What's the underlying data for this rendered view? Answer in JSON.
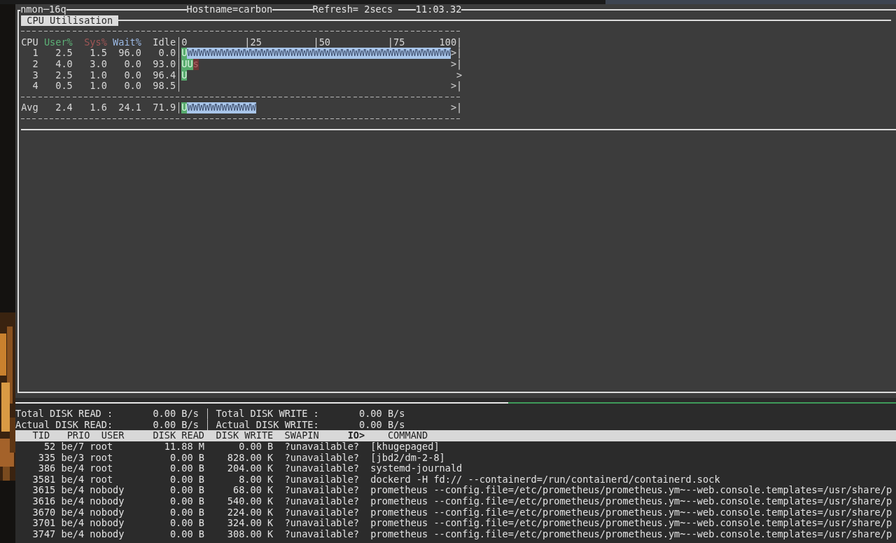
{
  "header": {
    "title": "nmon─16q",
    "hostname": "Hostname=carbon",
    "refresh": "Refresh= 2secs",
    "time": "11:03.32"
  },
  "cpu_panel": {
    "title": "CPU Utilisation",
    "columns": [
      {
        "label": "CPU",
        "kind": "cpu"
      },
      {
        "label": "User%",
        "kind": "user"
      },
      {
        "label": "Sys%",
        "kind": "sys"
      },
      {
        "label": "Wait%",
        "kind": "wait"
      },
      {
        "label": "Idle",
        "kind": "idle"
      }
    ],
    "scale": [
      "0",
      "|25",
      "|50",
      "|75",
      "100|"
    ],
    "rows": [
      {
        "cpu": "1",
        "user": "2.5",
        "sys": "1.5",
        "wait": "96.0",
        "idle": "0.0",
        "bar": [
          {
            "kind": "user",
            "text": "U"
          },
          {
            "kind": "wait",
            "text": "WWWWWWWWWWWWWWWWWWWWWWWWWWWWWWWWWWWWWWWWWWWWWW"
          }
        ],
        "end": ">|"
      },
      {
        "cpu": "2",
        "user": "4.0",
        "sys": "3.0",
        "wait": "0.0",
        "idle": "93.0",
        "bar": [
          {
            "kind": "user",
            "text": "UU"
          },
          {
            "kind": "sys",
            "text": "s"
          }
        ],
        "end": ">|"
      },
      {
        "cpu": "3",
        "user": "2.5",
        "sys": "1.0",
        "wait": "0.0",
        "idle": "96.4",
        "bar": [
          {
            "kind": "user",
            "text": "U"
          }
        ],
        "end": ">"
      },
      {
        "cpu": "4",
        "user": "0.5",
        "sys": "1.0",
        "wait": "0.0",
        "idle": "98.5",
        "bar": [],
        "end": ">|"
      }
    ],
    "average": {
      "cpu": "Avg",
      "user": "2.4",
      "sys": "1.6",
      "wait": "24.1",
      "idle": "71.9",
      "bar": [
        {
          "kind": "user",
          "text": "U"
        },
        {
          "kind": "wait",
          "text": "WWWWWWWWWWWW"
        }
      ],
      "end": ">|"
    }
  },
  "io_panel": {
    "totals": [
      {
        "read_label": "Total DISK READ :",
        "read_value": "0.00 B/s",
        "write_label": "Total DISK WRITE :",
        "write_value": "0.00 B/s"
      },
      {
        "read_label": "Actual DISK READ:",
        "read_value": "0.00 B/s",
        "write_label": "Actual DISK WRITE:",
        "write_value": "0.00 B/s"
      }
    ],
    "columns": [
      {
        "label": "TID",
        "sorted": false
      },
      {
        "label": "PRIO",
        "sorted": false
      },
      {
        "label": "USER",
        "sorted": false
      },
      {
        "label": "DISK READ",
        "sorted": false
      },
      {
        "label": "DISK WRITE",
        "sorted": false
      },
      {
        "label": "SWAPIN",
        "sorted": false
      },
      {
        "label": "IO>",
        "sorted": true
      },
      {
        "label": "COMMAND",
        "sorted": false
      }
    ],
    "rows": [
      {
        "tid": "52",
        "prio": "be/7",
        "user": "root",
        "disk_read": "11.88 M",
        "disk_write": "0.00 B",
        "swapin": "?unavailable?",
        "command": "[khugepaged]"
      },
      {
        "tid": "335",
        "prio": "be/3",
        "user": "root",
        "disk_read": "0.00 B",
        "disk_write": "828.00 K",
        "swapin": "?unavailable?",
        "command": "[jbd2/dm-2-8]"
      },
      {
        "tid": "386",
        "prio": "be/4",
        "user": "root",
        "disk_read": "0.00 B",
        "disk_write": "204.00 K",
        "swapin": "?unavailable?",
        "command": "systemd-journald"
      },
      {
        "tid": "3581",
        "prio": "be/4",
        "user": "root",
        "disk_read": "0.00 B",
        "disk_write": "8.00 K",
        "swapin": "?unavailable?",
        "command": "dockerd -H fd:// --containerd=/run/containerd/containerd.sock"
      },
      {
        "tid": "3615",
        "prio": "be/4",
        "user": "nobody",
        "disk_read": "0.00 B",
        "disk_write": "68.00 K",
        "swapin": "?unavailable?",
        "command": "prometheus --config.file=/etc/prometheus/prometheus.ym~--web.console.templates=/usr/share/p"
      },
      {
        "tid": "3616",
        "prio": "be/4",
        "user": "nobody",
        "disk_read": "0.00 B",
        "disk_write": "540.00 K",
        "swapin": "?unavailable?",
        "command": "prometheus --config.file=/etc/prometheus/prometheus.ym~--web.console.templates=/usr/share/p"
      },
      {
        "tid": "3670",
        "prio": "be/4",
        "user": "nobody",
        "disk_read": "0.00 B",
        "disk_write": "224.00 K",
        "swapin": "?unavailable?",
        "command": "prometheus --config.file=/etc/prometheus/prometheus.ym~--web.console.templates=/usr/share/p"
      },
      {
        "tid": "3701",
        "prio": "be/4",
        "user": "nobody",
        "disk_read": "0.00 B",
        "disk_write": "324.00 K",
        "swapin": "?unavailable?",
        "command": "prometheus --config.file=/etc/prometheus/prometheus.ym~--web.console.templates=/usr/share/p"
      },
      {
        "tid": "3747",
        "prio": "be/4",
        "user": "nobody",
        "disk_read": "0.00 B",
        "disk_write": "308.00 K",
        "swapin": "?unavailable?",
        "command": "prometheus --config.file=/etc/prometheus/prometheus.ym~--web.console.templates=/usr/share/p"
      }
    ]
  }
}
